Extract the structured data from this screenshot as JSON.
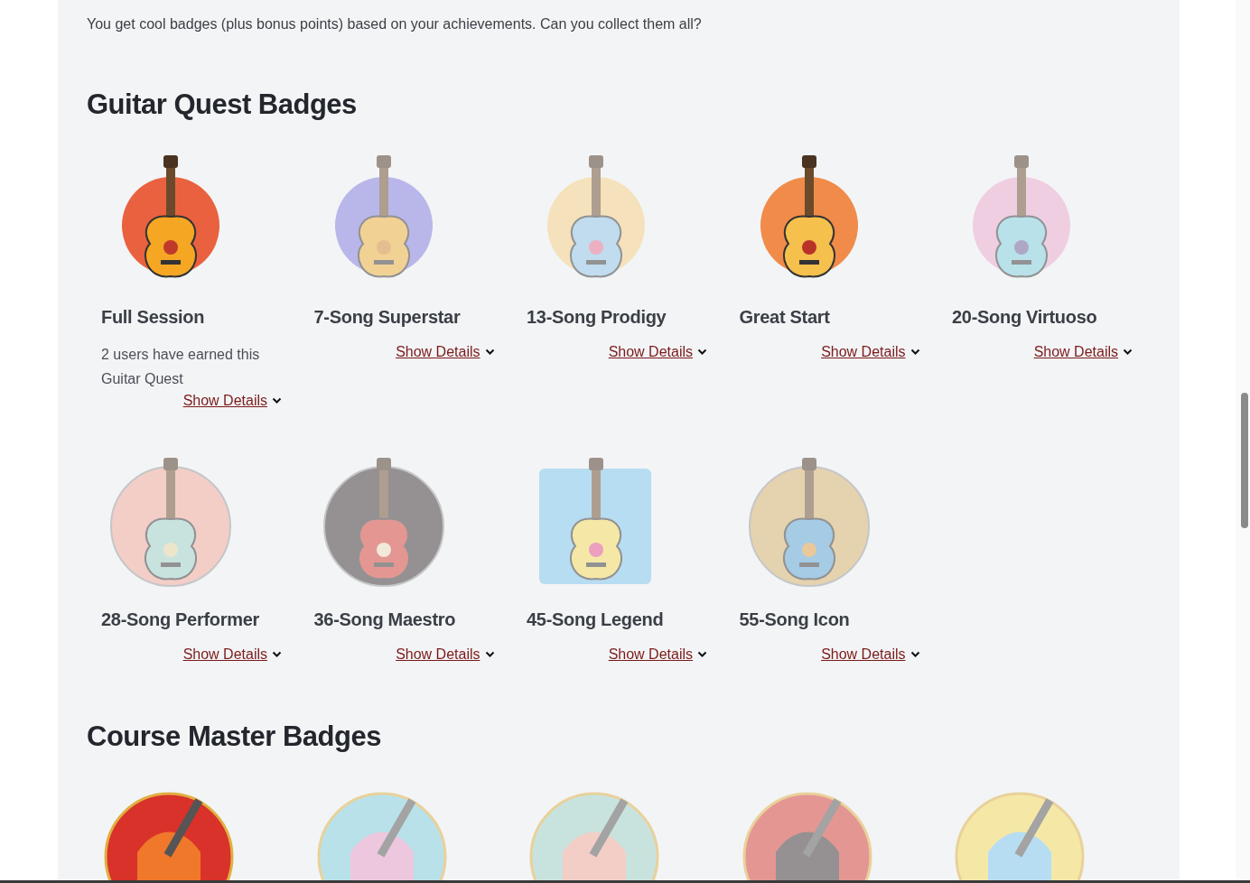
{
  "intro": "You get cool badges (plus bonus points) based on your achievements. Can you collect them all?",
  "sections": [
    {
      "title": "Guitar Quest Badges",
      "badges": [
        {
          "name": "Full Session",
          "earned": true,
          "note": "2 users have earned this Guitar Quest",
          "link": "Show Details"
        },
        {
          "name": "7-Song Superstar",
          "earned": false,
          "link": "Show Details"
        },
        {
          "name": "13-Song Prodigy",
          "earned": false,
          "link": "Show Details"
        },
        {
          "name": "Great Start",
          "earned": true,
          "link": "Show Details"
        },
        {
          "name": "20-Song Virtuoso",
          "earned": false,
          "link": "Show Details"
        },
        {
          "name": "28-Song Performer",
          "earned": false,
          "link": "Show Details"
        },
        {
          "name": "36-Song Maestro",
          "earned": false,
          "link": "Show Details"
        },
        {
          "name": "45-Song Legend",
          "earned": false,
          "link": "Show Details"
        },
        {
          "name": "55-Song Icon",
          "earned": false,
          "link": "Show Details"
        }
      ]
    },
    {
      "title": "Course Master Badges",
      "badges": [
        {
          "earned": true
        },
        {
          "earned": false
        },
        {
          "earned": false
        },
        {
          "earned": false
        },
        {
          "earned": false
        }
      ]
    }
  ]
}
